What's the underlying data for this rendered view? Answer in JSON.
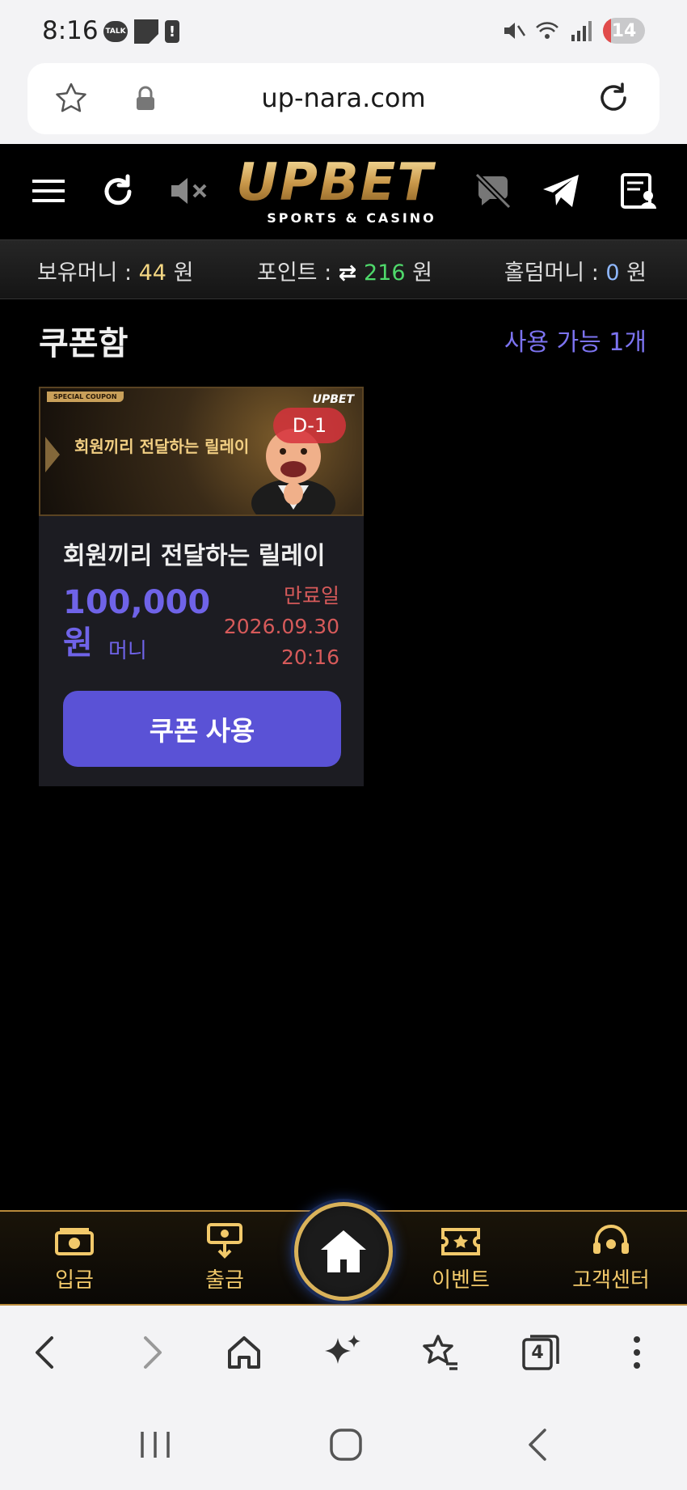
{
  "status_bar": {
    "time": "8:16",
    "talk_badge": "TALK",
    "alert_badge": "!",
    "battery_level": "14"
  },
  "browser": {
    "url": "up-nara.com",
    "tab_count": "4"
  },
  "site": {
    "logo_main": "UPBET",
    "logo_sub": "SPORTS & CASINO"
  },
  "balances": {
    "money_label": "보유머니 : ",
    "money_value": "44",
    "money_unit": " 원",
    "point_label": "포인트 : ",
    "point_icon": "⇄",
    "point_value": "216",
    "point_unit": " 원",
    "holdem_label": "홀덤머니 : ",
    "holdem_value": "0",
    "holdem_unit": " 원"
  },
  "coupons": {
    "title": "쿠폰함",
    "available": "사용 가능 1개",
    "items": [
      {
        "banner_tag": "SPECIAL COUPON",
        "banner_logo": "UPBET",
        "banner_text": "회원끼리 전달하는 릴레이",
        "dday": "D-1",
        "name": "회원끼리 전달하는 릴레이",
        "amount": "100,000",
        "amount_unit": "원",
        "type": "머니",
        "expiry_label": "만료일",
        "expiry_date": "2026.09.30",
        "expiry_time": "20:16",
        "button": "쿠폰 사용"
      }
    ]
  },
  "bottom_nav": {
    "deposit": "입금",
    "withdraw": "출금",
    "event": "이벤트",
    "support": "고객센터"
  },
  "colors": {
    "accent": "#5a52d6",
    "gold": "#f2c96a",
    "expiry": "#d65a5a"
  }
}
